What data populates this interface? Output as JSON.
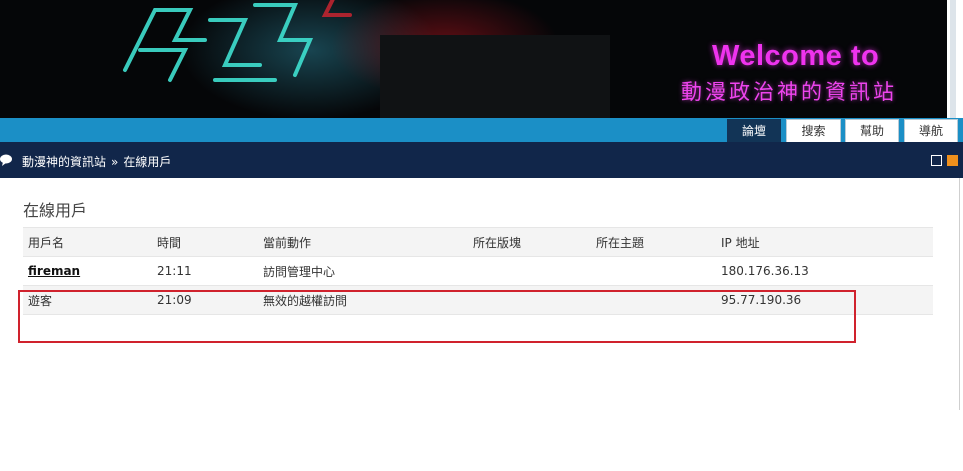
{
  "banner": {
    "welcome": "Welcome to",
    "subtitle": "動漫政治神的資訊站"
  },
  "nav": {
    "tabs": [
      {
        "label": "論壇",
        "active": true
      },
      {
        "label": "搜索",
        "active": false
      },
      {
        "label": "幫助",
        "active": false
      },
      {
        "label": "導航",
        "active": false
      }
    ]
  },
  "breadcrumb": {
    "home": "動漫神的資訊站",
    "separator": "»",
    "current": "在線用戶"
  },
  "page": {
    "title": "在線用戶"
  },
  "table": {
    "headers": [
      "用戶名",
      "時間",
      "當前動作",
      "所在版塊",
      "所在主題",
      "IP 地址"
    ],
    "rows": [
      {
        "user": "fireman",
        "time": "21:11",
        "action": "訪問管理中心",
        "forum": "",
        "topic": "",
        "ip": "180.176.36.13"
      },
      {
        "user": "遊客",
        "time": "21:09",
        "action": "無效的越權訪問",
        "forum": "",
        "topic": "",
        "ip": "95.77.190.36"
      }
    ]
  },
  "colors": {
    "nav_bar": "#1b8fc6",
    "crumb_bar": "#11264a",
    "highlight": "#d0222d",
    "welcome_text": "#ee33ee"
  }
}
